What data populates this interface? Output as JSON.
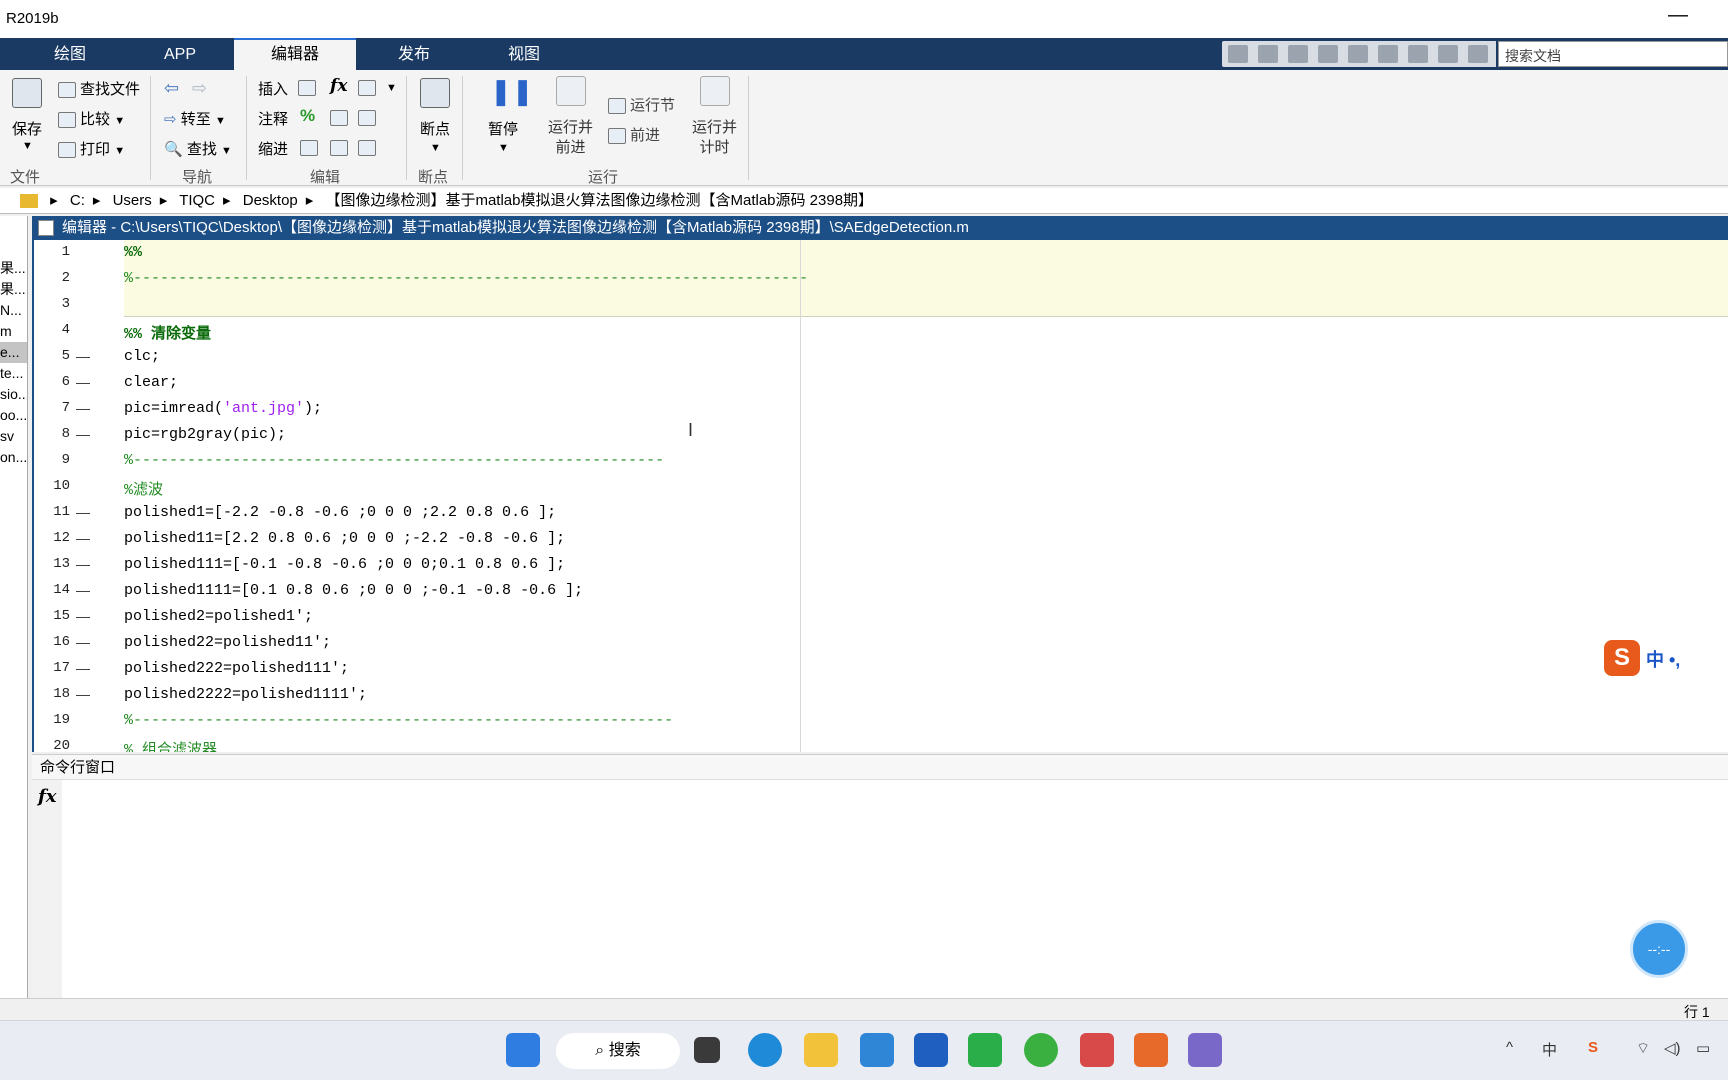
{
  "window": {
    "title": "R2019b",
    "minimize": "—"
  },
  "tabs": [
    {
      "label": "绘图"
    },
    {
      "label": "APP"
    },
    {
      "label": "编辑器"
    },
    {
      "label": "发布"
    },
    {
      "label": "视图"
    }
  ],
  "search": {
    "placeholder": "搜索文档"
  },
  "ribbon": {
    "file": {
      "save": "保存",
      "find_files": "查找文件",
      "compare": "比较",
      "print": "打印",
      "group": "文件"
    },
    "nav": {
      "goto": "转至",
      "find": "查找",
      "group": "导航"
    },
    "edit": {
      "insert": "插入",
      "fx": "fx",
      "comment": "注释",
      "percent": "%",
      "indent": "缩进",
      "group": "编辑"
    },
    "breakpoints": {
      "label": "断点",
      "group": "断点"
    },
    "run": {
      "pause": "暂停",
      "run_advance": "运行并\n前进",
      "run_section": "运行节",
      "advance": "前进",
      "run_time": "运行并\n计时",
      "group": "运行"
    }
  },
  "path": {
    "parts": [
      "C:",
      "Users",
      "TIQC",
      "Desktop",
      "【图像边缘检测】基于matlab模拟退火算法图像边缘检测【含Matlab源码 2398期】"
    ]
  },
  "left_pane": {
    "items": [
      "果...",
      "果...",
      "N...",
      "m",
      "e...",
      "te...",
      "sio...",
      "oo...",
      "sv",
      "on..."
    ]
  },
  "editor": {
    "header": "编辑器 - C:\\Users\\TIQC\\Desktop\\【图像边缘检测】基于matlab模拟退火算法图像边缘检测【含Matlab源码 2398期】\\SAEdgeDetection.m",
    "lines": [
      {
        "n": "1",
        "dash": "",
        "text": "%%",
        "cls": "cmtb"
      },
      {
        "n": "2",
        "dash": "",
        "text": "%---------------------------------------------------------------------------",
        "cls": "cmt"
      },
      {
        "n": "3",
        "dash": "",
        "text": "",
        "cls": ""
      },
      {
        "n": "4",
        "dash": "",
        "text": "%% 清除变量",
        "cls": "cmtb"
      },
      {
        "n": "5",
        "dash": "—",
        "text": "clc;",
        "cls": ""
      },
      {
        "n": "6",
        "dash": "—",
        "text": "clear;",
        "cls": ""
      },
      {
        "n": "7",
        "dash": "—",
        "text": "pic=imread('ant.jpg');",
        "cls": "str7"
      },
      {
        "n": "8",
        "dash": "—",
        "text": "pic=rgb2gray(pic);",
        "cls": ""
      },
      {
        "n": "9",
        "dash": "",
        "text": "%-----------------------------------------------------------",
        "cls": "cmt"
      },
      {
        "n": "10",
        "dash": "",
        "text": "%滤波",
        "cls": "cmt"
      },
      {
        "n": "11",
        "dash": "—",
        "text": "polished1=[-2.2 -0.8 -0.6 ;0 0 0 ;2.2 0.8 0.6 ];",
        "cls": ""
      },
      {
        "n": "12",
        "dash": "—",
        "text": "polished11=[2.2 0.8 0.6 ;0 0 0 ;-2.2 -0.8 -0.6 ];",
        "cls": ""
      },
      {
        "n": "13",
        "dash": "—",
        "text": "polished111=[-0.1 -0.8 -0.6 ;0 0 0;0.1 0.8 0.6 ];",
        "cls": ""
      },
      {
        "n": "14",
        "dash": "—",
        "text": "polished1111=[0.1 0.8 0.6 ;0 0 0 ;-0.1 -0.8 -0.6 ];",
        "cls": ""
      },
      {
        "n": "15",
        "dash": "—",
        "text": "polished2=polished1';",
        "cls": ""
      },
      {
        "n": "16",
        "dash": "—",
        "text": "polished22=polished11';",
        "cls": ""
      },
      {
        "n": "17",
        "dash": "—",
        "text": "polished222=polished111';",
        "cls": ""
      },
      {
        "n": "18",
        "dash": "—",
        "text": "polished2222=polished1111';",
        "cls": ""
      },
      {
        "n": "19",
        "dash": "",
        "text": "%------------------------------------------------------------",
        "cls": "cmt"
      },
      {
        "n": "20",
        "dash": "",
        "text": "% 组合滤波器",
        "cls": "cmt"
      }
    ]
  },
  "command_window": {
    "title": "命令行窗口",
    "prompt": "fx"
  },
  "status": {
    "row": "行 1"
  },
  "ime": {
    "label": "中 •,",
    "logo": "S"
  },
  "bubble": {
    "text": "--:--"
  },
  "taskbar": {
    "search": "搜索"
  },
  "tray": {
    "ime": "中"
  }
}
